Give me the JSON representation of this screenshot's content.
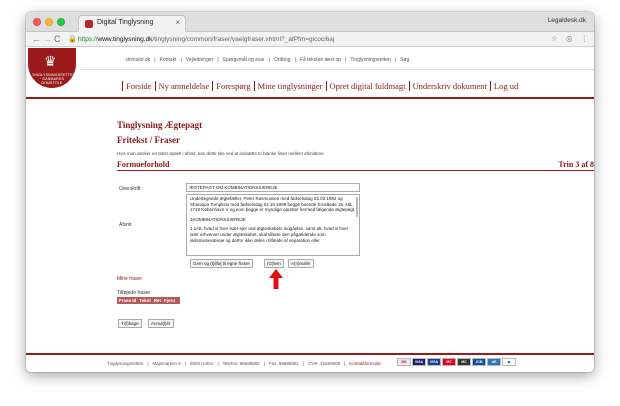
{
  "browser": {
    "tab_title": "Digital Tinglysning",
    "tab_close": "×",
    "profile": "Legaldesk.dk",
    "nav_back": "←",
    "nav_forward": "→",
    "nav_reload": "C",
    "url_scheme": "https://",
    "url_host": "www.tinglysning.dk",
    "url_path": "/tinglysning/common/fraser/vaelgfraser.xhtml?_afPfm=gicoci6aj",
    "icons": [
      "star-icon",
      "extension-icon",
      "menu-icon"
    ]
  },
  "site": {
    "logo_text": "TINGLYSNINGSRETTEN · DANMARKS DOMSTOLE",
    "top_links": [
      "domstol.dk",
      "Kontakt",
      "Vejledninger",
      "Spørgsmål og svar",
      "Ordbog",
      "Få teksten læst op",
      "Tinglysningsretten",
      "Søg"
    ],
    "main_nav": [
      "Forside",
      "Ny anmeldelse",
      "Forespørg",
      "Mine tinglysninger",
      "Opret digital fuldmagt",
      "Underskriv dokument",
      "Log ud"
    ]
  },
  "content": {
    "heading": "Tinglysning Ægtepagt",
    "subheading": "Fritekst / Fraser",
    "info": "Hvis man ønsker en tekst opdelt i afsnit, kan dette ske ved at indsætte to blanke linier mellem afsnittene.",
    "section_title": "Formueforhold",
    "step": "Trin 3 af 8",
    "overskrift_label": "Overskrift",
    "overskrift_value": "ÆGTEPAGT OM KOMBINATIONSSÆREJE",
    "afsnit_label": "Afsnit",
    "afsnit_paragraphs": [
      "Undertegnede ægtefæller, Peter Rasmussen med fødselsdag 03.03.1982 og Shaniqua Tompkins med fødselsdag 02.10.1989 begge boende Krusåede 19, kld., 1719 København V og som begge er myndige opretter hermed følgende ægtepagt.",
      "1KOMBINATIONSSÆREJE",
      "1.1Alt, hvad vi hver især ejer ved ægteskabets indgåelse, samt alt, hvad vi hver især erhverver under ægteskabet, skal tilhøre den pågældende som skilsmissesæreje og derfor ikke deles i tilfælde af separation eller"
    ],
    "btn_gem": "Gem og (t)ilføj til egne fraser",
    "btn_glem": "(G)lem",
    "btn_annuller": "A(n)nullér",
    "mine_fraser": "Mine fraser",
    "tilfoejede": "Tilføjede fraser",
    "table_headers": [
      "Frase Id",
      "Tekst",
      "Ret",
      "Fjern"
    ],
    "btn_tilbage": "Ti(l)bage",
    "btn_annuller2": "Annul(l)ér"
  },
  "footer": {
    "items": [
      "Tinglysningsretten",
      "Majsmarken 5",
      "9500 Hobro",
      "Telefon: 99685800",
      "Fax: 99685801",
      "CVR: 21659509"
    ],
    "kontakt": "Kontaktformular",
    "cards": [
      {
        "label": "DK",
        "color": "#e8e8e8",
        "text": "#c0102a"
      },
      {
        "label": "VISA",
        "color": "#1a1f71",
        "text": "#ffffff"
      },
      {
        "label": "VISA",
        "color": "#1a3f91",
        "text": "#ffffff"
      },
      {
        "label": "MC",
        "color": "#eb001b",
        "text": "#ffffff"
      },
      {
        "label": "MC",
        "color": "#333333",
        "text": "#ffffff"
      },
      {
        "label": "JCB",
        "color": "#0e4c96",
        "text": "#ffffff"
      },
      {
        "label": "AE",
        "color": "#2e77bc",
        "text": "#ffffff"
      },
      {
        "label": "◈",
        "color": "#ffffff",
        "text": "#1a3f91"
      }
    ]
  },
  "colors": {
    "brand": "#9b1b1b",
    "arrow": "#e01010"
  }
}
